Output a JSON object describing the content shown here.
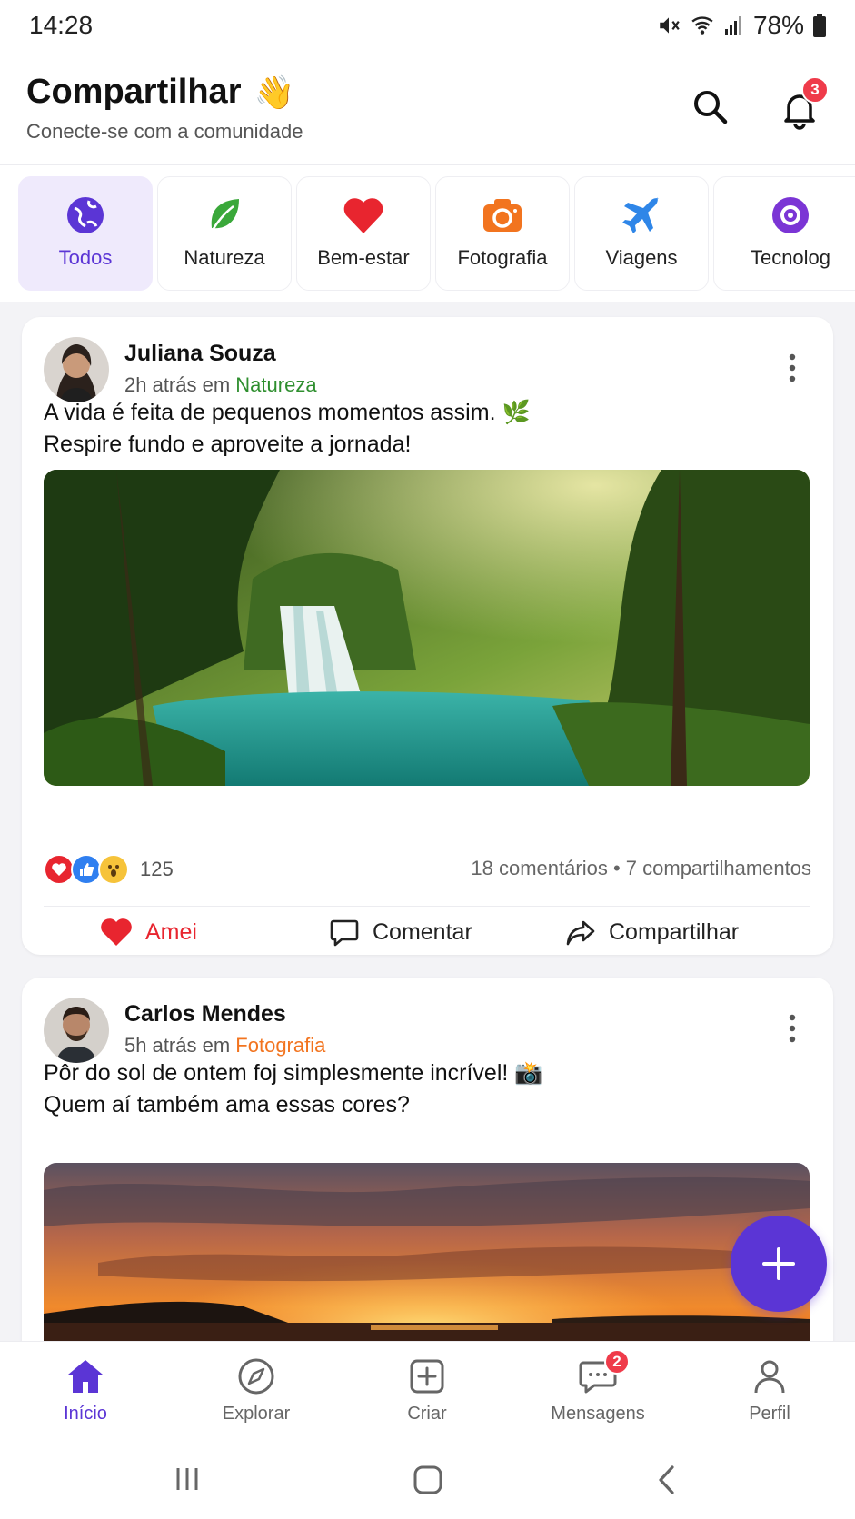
{
  "status_bar": {
    "time": "14:28",
    "battery": "78%"
  },
  "header": {
    "title": "Compartilhar",
    "subtitle": "Conecte-se com a comunidade",
    "notification_count": "3"
  },
  "categories": [
    {
      "label": "Todos",
      "icon": "globe-icon",
      "active": true,
      "color": "#5b35d5"
    },
    {
      "label": "Natureza",
      "icon": "leaf-icon",
      "color": "#3aa83a"
    },
    {
      "label": "Bem-estar",
      "icon": "heart-icon",
      "color": "#e8252f"
    },
    {
      "label": "Fotografia",
      "icon": "camera-icon",
      "color": "#f2741f"
    },
    {
      "label": "Viagens",
      "icon": "airplane-icon",
      "color": "#2f86e8"
    },
    {
      "label": "Tecnolog",
      "icon": "tech-icon",
      "color": "#7b35d5"
    }
  ],
  "posts": [
    {
      "author": "Juliana Souza",
      "time": "2h atrás em",
      "category": "Natureza",
      "category_color": "#2f8f2f",
      "text_line1": "A vida é feita de pequenos momentos assim. 🌿",
      "text_line2": "Respire fundo e aproveite a jornada!",
      "reaction_count": "125",
      "comments": "18 comentários",
      "shares": "7 compartilhamentos",
      "actions": {
        "like": "Amei",
        "comment": "Comentar",
        "share": "Compartilhar"
      }
    },
    {
      "author": "Carlos Mendes",
      "time": "5h atrás em",
      "category": "Fotografia",
      "category_color": "#f2741f",
      "text_line1": "Pôr do sol de ontem foj simplesmente incrível! 📸",
      "text_line2": "Quem aí também ama essas cores?"
    }
  ],
  "bottom_nav": [
    {
      "label": "Início",
      "icon": "home-icon",
      "active": true
    },
    {
      "label": "Explorar",
      "icon": "compass-icon"
    },
    {
      "label": "Criar",
      "icon": "plus-square-icon"
    },
    {
      "label": "Mensagens",
      "icon": "chat-icon",
      "badge": "2"
    },
    {
      "label": "Perfil",
      "icon": "person-icon"
    }
  ],
  "colors": {
    "accent": "#5b35d5",
    "like": "#e8252f"
  }
}
